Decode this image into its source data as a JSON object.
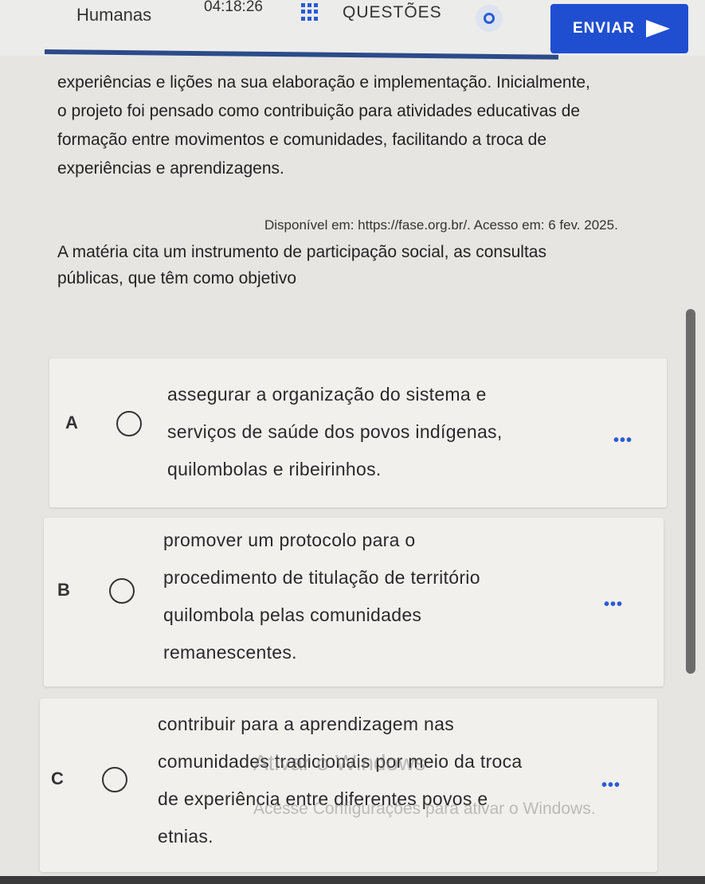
{
  "header": {
    "subject": "Humanas",
    "timer": "04:18:26",
    "questions_label": "QUESTÕES",
    "send_label": "ENVIAR"
  },
  "passage": {
    "lines": [
      "experiências e lições na sua elaboração e implementação. Inicialmente,",
      "o projeto foi pensado como contribuição para atividades educativas de",
      "formação entre movimentos e comunidades, facilitando a troca de",
      "experiências e aprendizagens."
    ],
    "source": "Disponível em: https://fase.org.br/. Acesso em: 6 fev. 2025."
  },
  "question": {
    "lines": [
      "A matéria cita um instrumento de participação social, as consultas",
      "públicas, que têm como objetivo"
    ]
  },
  "options": [
    {
      "letter": "A",
      "lines": [
        "assegurar a organização do sistema e",
        "serviços de saúde dos povos indígenas,",
        "quilombolas e ribeirinhos."
      ],
      "more": "•••"
    },
    {
      "letter": "B",
      "lines": [
        "promover um protocolo para o",
        "procedimento de titulação de território",
        "quilombola pelas comunidades",
        "remanescentes."
      ],
      "more": "•••"
    },
    {
      "letter": "C",
      "lines": [
        "contribuir para a aprendizagem nas",
        "comunidades tradicionais por meio da troca",
        "de experiência entre diferentes povos e",
        "etnias."
      ],
      "more": "•••"
    }
  ],
  "watermark": {
    "title": "Ativar o Windows",
    "subtitle": "Acesse Configurações para ativar o Windows."
  },
  "colors": {
    "accent": "#1f4ed0",
    "background": "#e6e5e1"
  }
}
